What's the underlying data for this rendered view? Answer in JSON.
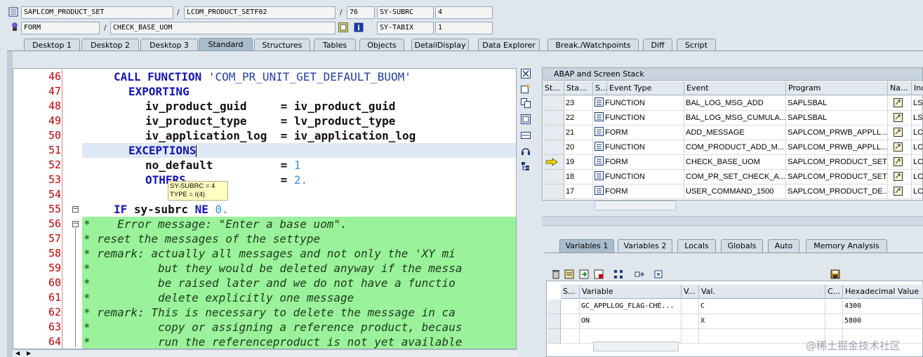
{
  "header": {
    "program": "SAPLCOM_PRODUCT_SET",
    "include": "LCOM_PRODUCT_SETF02",
    "line": "76",
    "sysvar1_name": "SY-SUBRC",
    "sysvar1_value": "4",
    "event_type": "FORM",
    "event_name": "CHECK_BASE_UOM",
    "sysvar2_name": "SY-TABIX",
    "sysvar2_value": "1",
    "sep1": "/",
    "sep2": "/",
    "sep3": "/"
  },
  "tabs": [
    "Desktop 1",
    "Desktop 2",
    "Desktop 3",
    "Standard",
    "Structures",
    "Tables",
    "Objects",
    "DetailDisplay",
    "Data Explorer",
    "Break./Watchpoints",
    "Diff",
    "Script"
  ],
  "active_tab": "Standard",
  "editor": {
    "line_numbers": [
      "46",
      "47",
      "48",
      "49",
      "50",
      "51",
      "52",
      "53",
      "54",
      "55",
      "56",
      "57",
      "58",
      "59",
      "60",
      "61",
      "62",
      "63",
      "64"
    ],
    "tooltip_line1": "SY-SUBRC = 4",
    "tooltip_line2": "TYPE = I(4)",
    "code": {
      "l46_kw": "CALL FUNCTION",
      "l46_str": " 'COM_PR_UNIT_GET_DEFAULT_BUOM'",
      "l47_kw": "EXPORTING",
      "l48_txt": "iv_product_guid     = iv_product_guid",
      "l49_txt": "iv_product_type     = lv_product_type",
      "l50_txt": "iv_application_log  = iv_application_log",
      "l51_kw": "EXCEPTIONS",
      "l52_txt": "no_default          = ",
      "l52_num": "1",
      "l53_kw": "OTHERS",
      "l53_txt": "              = ",
      "l53_num": "2.",
      "l55_kw1": "IF",
      "l55_txt": " sy-subrc ",
      "l55_kw2": "NE",
      "l55_num": " 0.",
      "l56": "*    Error message: \"Enter a base uom\".",
      "l57": "* reset the messages of the settype",
      "l58": "* remark: actually all messages and not only the 'XY mi",
      "l59": "*          but they would be deleted anyway if the messa",
      "l60": "*          be raised later and we do not have a functio",
      "l61": "*          delete explicitly one message",
      "l62": "* remark: This is necessary to delete the message in ca",
      "l63": "*          copy or assigning a reference product, becaus",
      "l64": "*          run the referenceproduct is not yet available"
    }
  },
  "stack": {
    "title": "ABAP and Screen Stack",
    "columns": [
      "St...",
      "Sta...",
      "S...",
      "Event Type",
      "Event",
      "Program",
      "Na...",
      "Inc"
    ],
    "rows": [
      {
        "level": "23",
        "type": "FUNCTION",
        "event": "BAL_LOG_MSG_ADD",
        "program": "SAPLSBAL",
        "inc": "LSB",
        "current": false
      },
      {
        "level": "22",
        "type": "FUNCTION",
        "event": "BAL_LOG_MSG_CUMULA...",
        "program": "SAPLSBAL",
        "inc": "LSB",
        "current": false
      },
      {
        "level": "21",
        "type": "FORM",
        "event": "ADD_MESSAGE",
        "program": "SAPLCOM_PRWB_APPLL...",
        "inc": "LCO",
        "current": false
      },
      {
        "level": "20",
        "type": "FUNCTION",
        "event": "COM_PRODUCT_ADD_M...",
        "program": "SAPLCOM_PRWB_APPLL...",
        "inc": "LCO",
        "current": false
      },
      {
        "level": "19",
        "type": "FORM",
        "event": "CHECK_BASE_UOM",
        "program": "SAPLCOM_PRODUCT_SET",
        "inc": "LCO",
        "current": true
      },
      {
        "level": "18",
        "type": "FUNCTION",
        "event": "COM_PR_SET_CHECK_A...",
        "program": "SAPLCOM_PRODUCT_SET",
        "inc": "LCO",
        "current": false
      },
      {
        "level": "17",
        "type": "FORM",
        "event": "USER_COMMAND_1500",
        "program": "SAPLCOM_PRODUCT_DE...",
        "inc": "LCO",
        "current": false
      }
    ]
  },
  "variable_tabs": [
    "Variables 1",
    "Variables 2",
    "Locals",
    "Globals",
    "Auto",
    "Memory Analysis"
  ],
  "active_variable_tab": "Variables 1",
  "variables": {
    "columns": [
      "S...",
      "Variable",
      "V...",
      "Val.",
      "C...",
      "Hexadecimal Value"
    ],
    "rows": [
      {
        "name": "GC_APPLLOG_FLAG-CHE...",
        "value": "C",
        "hex": "4300"
      },
      {
        "name": "ON",
        "value": "X",
        "hex": "5800"
      }
    ]
  },
  "watermark": "@稀土掘金技术社区",
  "colors": {
    "comment_bg": "#9af29a",
    "line_number": "#c00000",
    "keyword": "#1414b4"
  }
}
